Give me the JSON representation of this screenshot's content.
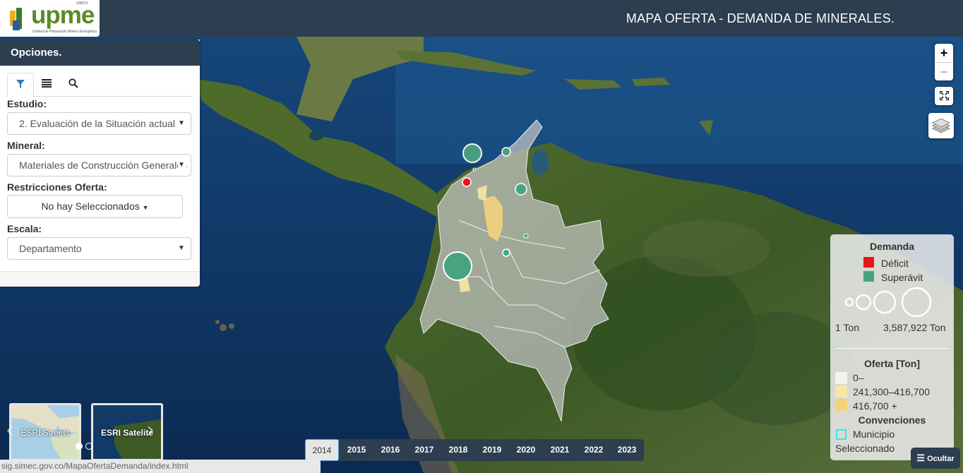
{
  "header": {
    "logo_text": "upme",
    "logo_subtitle": "Unidad de Planeación Minero Energética",
    "logo_tiny": "SIMCO",
    "title": "MAPA OFERTA - DEMANDA DE MINERALES."
  },
  "options": {
    "title": "Opciones.",
    "tabs": [
      {
        "icon": "filter-icon"
      },
      {
        "icon": "list-icon"
      },
      {
        "icon": "search-icon"
      }
    ],
    "estudio_label": "Estudio:",
    "estudio_value": "2. Evaluación de la Situación actual",
    "mineral_label": "Mineral:",
    "mineral_value": "Materiales de Construcción Generales",
    "restricciones_label": "Restricciones Oferta:",
    "restricciones_value": "No hay Seleccionados",
    "escala_label": "Escala:",
    "escala_value": "Departamento"
  },
  "map_controls": {
    "zoom_in": "+",
    "zoom_out": "−"
  },
  "legend": {
    "demanda_title": "Demanda",
    "deficit_label": "Déficit",
    "superavit_label": "Superávit",
    "size_min": "1 Ton",
    "size_max": "3,587,922 Ton",
    "oferta_title": "Oferta [Ton]",
    "oferta_classes": [
      {
        "label": "0–",
        "color": "#f2f2f2"
      },
      {
        "label": "241,300–416,700",
        "color": "#f7e6a6"
      },
      {
        "label": "416,700 +",
        "color": "#f3d27c"
      }
    ],
    "convenciones_title": "Convenciones",
    "municipio_label": "Municipio",
    "municipio_label2": "Seleccionado",
    "colors": {
      "deficit": "#e8141c",
      "superavit": "#4aa37f",
      "municipio": "#36e5ef"
    }
  },
  "hide_button": "Ocultar",
  "years": [
    "2014",
    "2015",
    "2016",
    "2017",
    "2018",
    "2019",
    "2020",
    "2021",
    "2022",
    "2023"
  ],
  "active_year": "2014",
  "basemaps": [
    "ESRI Streets",
    "ESRI Satelite"
  ],
  "status_url": "sig.simec.gov.co/MapaOfertaDemanda/index.html"
}
